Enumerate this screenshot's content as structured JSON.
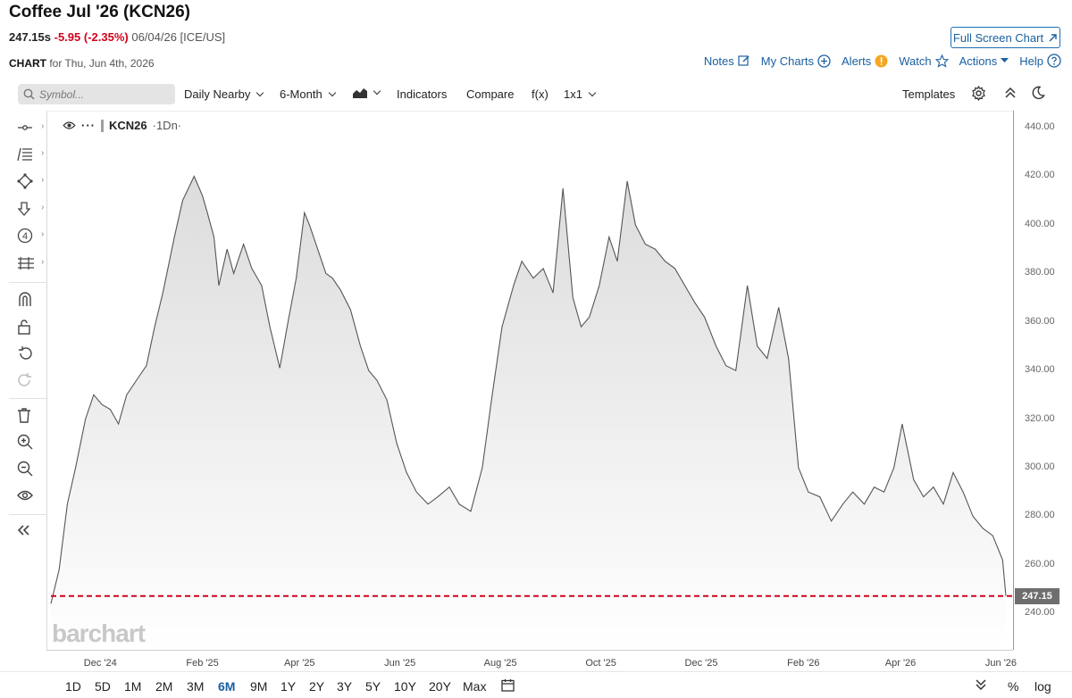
{
  "header": {
    "title": "Coffee Jul '26 (KCN26)",
    "price": "247.15s",
    "change": "-5.95 (-2.35%)",
    "meta": "06/04/26 [ICE/US]",
    "full_screen_label": "Full Screen Chart",
    "chart_label": "CHART",
    "chart_date": "for Thu, Jun 4th, 2026"
  },
  "actions": {
    "notes": "Notes",
    "my_charts": "My Charts",
    "alerts": "Alerts",
    "watch": "Watch",
    "actions": "Actions",
    "help": "Help"
  },
  "toolbar": {
    "search_placeholder": "Symbol...",
    "aggregation": "Daily Nearby",
    "period": "6-Month",
    "indicators": "Indicators",
    "compare": "Compare",
    "fx": "f(x)",
    "layout": "1x1",
    "templates": "Templates"
  },
  "legend": {
    "symbol": "KCN26",
    "interval": "·1Dn·"
  },
  "watermark": "barchart",
  "last_price_label": "247.15",
  "bottom": {
    "periods": [
      "1D",
      "5D",
      "1M",
      "2M",
      "3M",
      "6M",
      "9M",
      "1Y",
      "2Y",
      "3Y",
      "5Y",
      "10Y",
      "20Y",
      "Max"
    ],
    "active_period": "6M",
    "percent": "%",
    "log": "log"
  },
  "colors": {
    "accent": "#1a5fa0",
    "negative": "#d0021b",
    "line": "#555555",
    "area": "#e8e8e8",
    "last_price_line": "#d0021b",
    "axis": "#6cb36c"
  },
  "chart_data": {
    "type": "area",
    "title": "",
    "xlabel": "",
    "ylabel": "",
    "ylim": [
      225,
      447
    ],
    "y_ticks": [
      240,
      260,
      280,
      300,
      320,
      340,
      360,
      380,
      400,
      420,
      440
    ],
    "y_tick_labels": [
      "240.00",
      "260.00",
      "280.00",
      "300.00",
      "320.00",
      "340.00",
      "360.00",
      "380.00",
      "400.00",
      "420.00",
      "440.00"
    ],
    "x_tick_labels": [
      "Dec '24",
      "Feb '25",
      "Apr '25",
      "Jun '25",
      "Aug '25",
      "Oct '25",
      "Dec '25",
      "Feb '26",
      "Apr '26",
      "Jun '26"
    ],
    "x_start": "2024-11-01",
    "x_end": "2026-06-04",
    "last_price": 247.15,
    "series": [
      {
        "x": [
          "2024-11-01",
          "2024-11-06",
          "2024-11-11",
          "2024-11-16",
          "2024-11-22",
          "2024-11-27",
          "2024-12-02",
          "2024-12-07",
          "2024-12-12",
          "2024-12-17",
          "2024-12-23",
          "2024-12-29",
          "2025-01-03",
          "2025-01-08",
          "2025-01-15",
          "2025-01-20",
          "2025-01-27",
          "2025-02-01",
          "2025-02-04",
          "2025-02-08",
          "2025-02-11",
          "2025-02-16",
          "2025-02-20",
          "2025-02-26",
          "2025-03-03",
          "2025-03-09",
          "2025-03-14",
          "2025-03-20",
          "2025-03-25",
          "2025-03-30",
          "2025-04-04",
          "2025-04-07",
          "2025-04-12",
          "2025-04-17",
          "2025-04-21",
          "2025-04-26",
          "2025-05-02",
          "2025-05-08",
          "2025-05-13",
          "2025-05-18",
          "2025-05-24",
          "2025-05-30",
          "2025-06-05",
          "2025-06-11",
          "2025-06-18",
          "2025-06-24",
          "2025-07-01",
          "2025-07-07",
          "2025-07-14",
          "2025-07-21",
          "2025-07-27",
          "2025-08-02",
          "2025-08-09",
          "2025-08-14",
          "2025-08-21",
          "2025-08-27",
          "2025-09-02",
          "2025-09-08",
          "2025-09-14",
          "2025-09-19",
          "2025-09-24",
          "2025-09-30",
          "2025-10-06",
          "2025-10-11",
          "2025-10-17",
          "2025-10-22",
          "2025-10-28",
          "2025-11-03",
          "2025-11-09",
          "2025-11-15",
          "2025-11-21",
          "2025-11-27",
          "2025-12-03",
          "2025-12-10",
          "2025-12-16",
          "2025-12-22",
          "2025-12-29",
          "2026-01-04",
          "2026-01-10",
          "2026-01-17",
          "2026-01-23",
          "2026-01-29",
          "2026-02-04",
          "2026-02-11",
          "2026-02-18",
          "2026-02-25",
          "2026-03-03",
          "2026-03-10",
          "2026-03-16",
          "2026-03-22",
          "2026-03-28",
          "2026-04-02",
          "2026-04-09",
          "2026-04-15",
          "2026-04-21",
          "2026-04-27",
          "2026-05-03",
          "2026-05-09",
          "2026-05-15",
          "2026-05-21",
          "2026-05-27",
          "2026-06-02",
          "2026-06-04"
        ],
        "y": [
          244,
          258,
          285,
          300,
          320,
          330,
          326,
          324,
          318,
          330,
          336,
          342,
          358,
          372,
          395,
          410,
          420,
          412,
          405,
          395,
          375,
          390,
          380,
          392,
          382,
          375,
          358,
          341,
          360,
          378,
          405,
          400,
          390,
          380,
          378,
          373,
          365,
          350,
          340,
          336,
          328,
          310,
          298,
          290,
          285,
          288,
          292,
          285,
          282,
          300,
          330,
          358,
          375,
          385,
          378,
          382,
          372,
          415,
          370,
          358,
          362,
          375,
          395,
          385,
          418,
          400,
          392,
          390,
          385,
          382,
          375,
          368,
          362,
          350,
          342,
          340,
          375,
          350,
          345,
          366,
          345,
          300,
          290,
          288,
          278,
          285,
          290,
          285,
          292,
          290,
          300,
          318,
          295,
          288,
          292,
          285,
          298,
          290,
          280,
          275,
          272,
          262,
          247.15
        ]
      }
    ]
  }
}
